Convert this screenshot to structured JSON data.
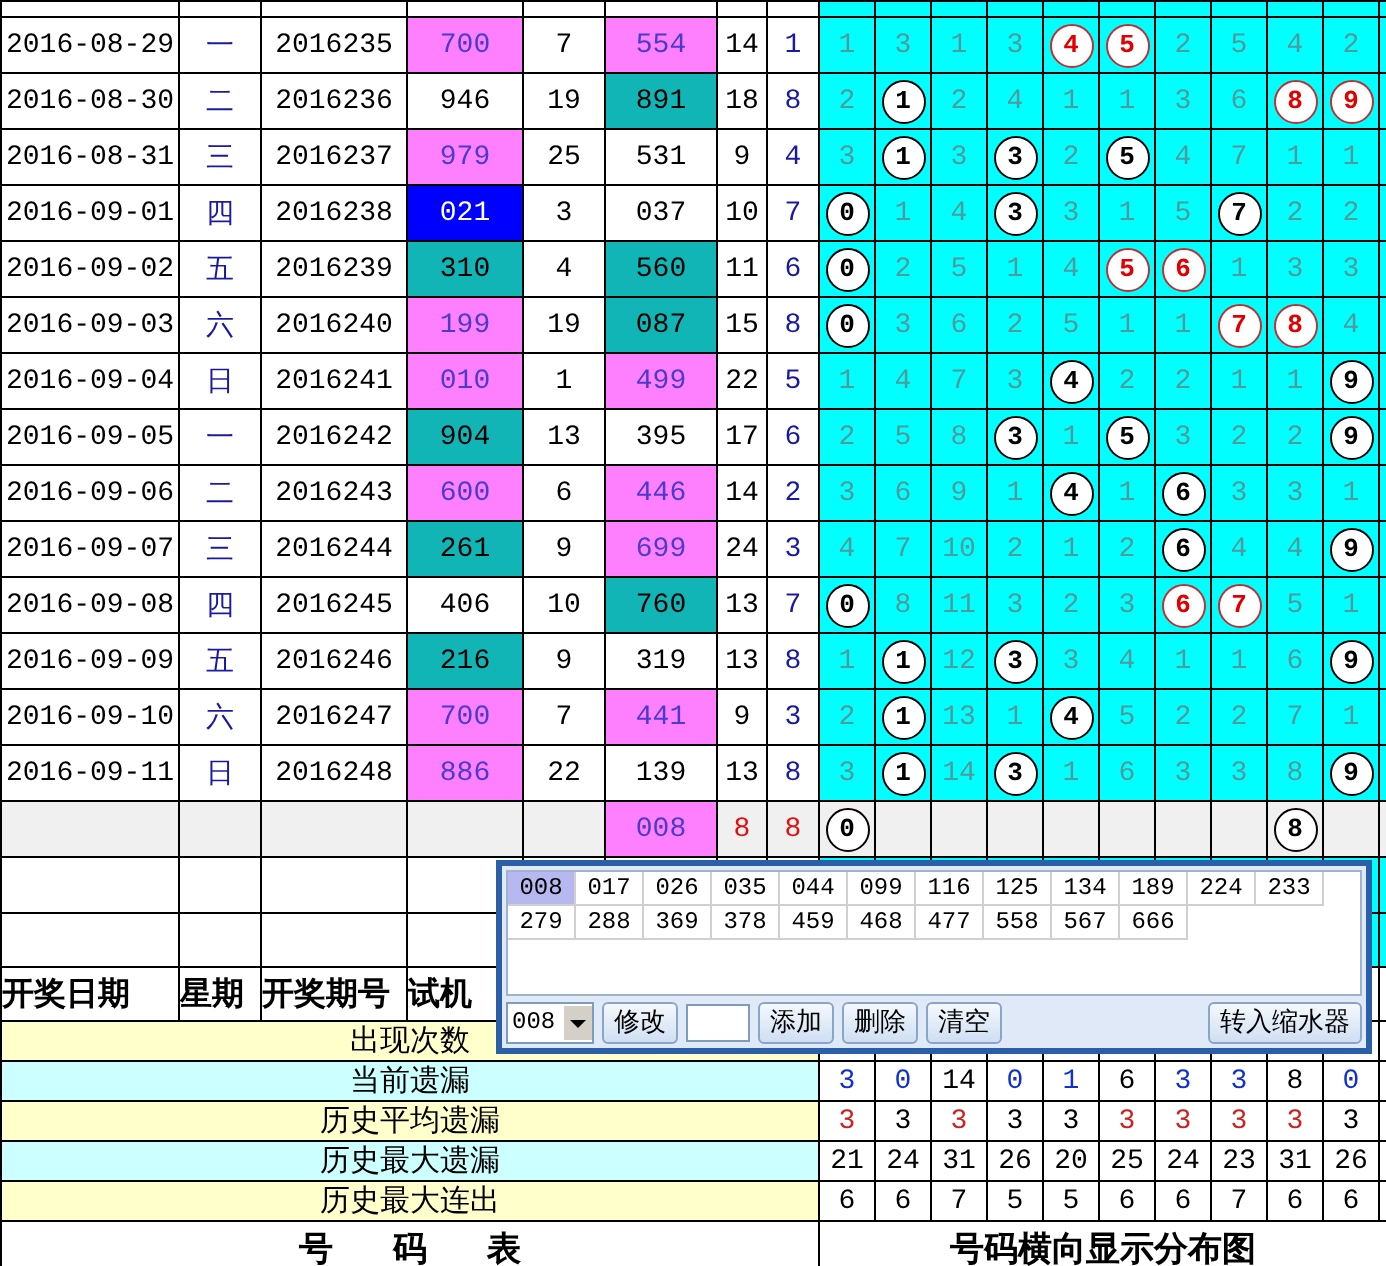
{
  "draws": [
    {
      "date": "2016-08-29",
      "weekday": "一",
      "issue": "2016235",
      "test": {
        "text": "700",
        "kind": "pink"
      },
      "c5": "7",
      "c6": {
        "text": "554",
        "kind": "pink"
      },
      "c7": "14",
      "c8": "1",
      "grid": [
        {
          "text": "1",
          "kind": "miss"
        },
        {
          "text": "3",
          "kind": "miss"
        },
        {
          "text": "1",
          "kind": "miss"
        },
        {
          "text": "3",
          "kind": "miss"
        },
        {
          "text": "4",
          "kind": "hit_red"
        },
        {
          "text": "5",
          "kind": "hit_red"
        },
        {
          "text": "2",
          "kind": "miss"
        },
        {
          "text": "5",
          "kind": "miss"
        },
        {
          "text": "4",
          "kind": "miss"
        },
        {
          "text": "2",
          "kind": "miss"
        }
      ]
    },
    {
      "date": "2016-08-30",
      "weekday": "二",
      "issue": "2016236",
      "test": {
        "text": "946",
        "kind": "white"
      },
      "c5": "19",
      "c6": {
        "text": "891",
        "kind": "teal"
      },
      "c7": "18",
      "c8": "8",
      "grid": [
        {
          "text": "2",
          "kind": "miss"
        },
        {
          "text": "1",
          "kind": "hit"
        },
        {
          "text": "2",
          "kind": "miss"
        },
        {
          "text": "4",
          "kind": "miss"
        },
        {
          "text": "1",
          "kind": "miss"
        },
        {
          "text": "1",
          "kind": "miss"
        },
        {
          "text": "3",
          "kind": "miss"
        },
        {
          "text": "6",
          "kind": "miss"
        },
        {
          "text": "8",
          "kind": "hit_red"
        },
        {
          "text": "9",
          "kind": "hit_red"
        }
      ]
    },
    {
      "date": "2016-08-31",
      "weekday": "三",
      "issue": "2016237",
      "test": {
        "text": "979",
        "kind": "pink"
      },
      "c5": "25",
      "c6": {
        "text": "531",
        "kind": "white"
      },
      "c7": "9",
      "c8": "4",
      "grid": [
        {
          "text": "3",
          "kind": "miss"
        },
        {
          "text": "1",
          "kind": "hit"
        },
        {
          "text": "3",
          "kind": "miss"
        },
        {
          "text": "3",
          "kind": "hit"
        },
        {
          "text": "2",
          "kind": "miss"
        },
        {
          "text": "5",
          "kind": "hit"
        },
        {
          "text": "4",
          "kind": "miss"
        },
        {
          "text": "7",
          "kind": "miss"
        },
        {
          "text": "1",
          "kind": "miss"
        },
        {
          "text": "1",
          "kind": "miss"
        }
      ]
    },
    {
      "date": "2016-09-01",
      "weekday": "四",
      "issue": "2016238",
      "test": {
        "text": "021",
        "kind": "blue"
      },
      "c5": "3",
      "c6": {
        "text": "037",
        "kind": "white"
      },
      "c7": "10",
      "c8": "7",
      "grid": [
        {
          "text": "0",
          "kind": "hit"
        },
        {
          "text": "1",
          "kind": "miss"
        },
        {
          "text": "4",
          "kind": "miss"
        },
        {
          "text": "3",
          "kind": "hit"
        },
        {
          "text": "3",
          "kind": "miss"
        },
        {
          "text": "1",
          "kind": "miss"
        },
        {
          "text": "5",
          "kind": "miss"
        },
        {
          "text": "7",
          "kind": "hit"
        },
        {
          "text": "2",
          "kind": "miss"
        },
        {
          "text": "2",
          "kind": "miss"
        }
      ]
    },
    {
      "date": "2016-09-02",
      "weekday": "五",
      "issue": "2016239",
      "test": {
        "text": "310",
        "kind": "teal"
      },
      "c5": "4",
      "c6": {
        "text": "560",
        "kind": "teal"
      },
      "c7": "11",
      "c8": "6",
      "grid": [
        {
          "text": "0",
          "kind": "hit"
        },
        {
          "text": "2",
          "kind": "miss"
        },
        {
          "text": "5",
          "kind": "miss"
        },
        {
          "text": "1",
          "kind": "miss"
        },
        {
          "text": "4",
          "kind": "miss"
        },
        {
          "text": "5",
          "kind": "hit_red"
        },
        {
          "text": "6",
          "kind": "hit_red"
        },
        {
          "text": "1",
          "kind": "miss"
        },
        {
          "text": "3",
          "kind": "miss"
        },
        {
          "text": "3",
          "kind": "miss"
        }
      ]
    },
    {
      "date": "2016-09-03",
      "weekday": "六",
      "issue": "2016240",
      "test": {
        "text": "199",
        "kind": "pink"
      },
      "c5": "19",
      "c6": {
        "text": "087",
        "kind": "teal"
      },
      "c7": "15",
      "c8": "8",
      "grid": [
        {
          "text": "0",
          "kind": "hit"
        },
        {
          "text": "3",
          "kind": "miss"
        },
        {
          "text": "6",
          "kind": "miss"
        },
        {
          "text": "2",
          "kind": "miss"
        },
        {
          "text": "5",
          "kind": "miss"
        },
        {
          "text": "1",
          "kind": "miss"
        },
        {
          "text": "1",
          "kind": "miss"
        },
        {
          "text": "7",
          "kind": "hit_red"
        },
        {
          "text": "8",
          "kind": "hit_red"
        },
        {
          "text": "4",
          "kind": "miss"
        }
      ]
    },
    {
      "date": "2016-09-04",
      "weekday": "日",
      "issue": "2016241",
      "test": {
        "text": "010",
        "kind": "pink"
      },
      "c5": "1",
      "c6": {
        "text": "499",
        "kind": "pink"
      },
      "c7": "22",
      "c8": "5",
      "grid": [
        {
          "text": "1",
          "kind": "miss"
        },
        {
          "text": "4",
          "kind": "miss"
        },
        {
          "text": "7",
          "kind": "miss"
        },
        {
          "text": "3",
          "kind": "miss"
        },
        {
          "text": "4",
          "kind": "hit"
        },
        {
          "text": "2",
          "kind": "miss"
        },
        {
          "text": "2",
          "kind": "miss"
        },
        {
          "text": "1",
          "kind": "miss"
        },
        {
          "text": "1",
          "kind": "miss"
        },
        {
          "text": "9",
          "kind": "hit"
        }
      ]
    },
    {
      "date": "2016-09-05",
      "weekday": "一",
      "issue": "2016242",
      "test": {
        "text": "904",
        "kind": "teal"
      },
      "c5": "13",
      "c6": {
        "text": "395",
        "kind": "white"
      },
      "c7": "17",
      "c8": "6",
      "grid": [
        {
          "text": "2",
          "kind": "miss"
        },
        {
          "text": "5",
          "kind": "miss"
        },
        {
          "text": "8",
          "kind": "miss"
        },
        {
          "text": "3",
          "kind": "hit"
        },
        {
          "text": "1",
          "kind": "miss"
        },
        {
          "text": "5",
          "kind": "hit"
        },
        {
          "text": "3",
          "kind": "miss"
        },
        {
          "text": "2",
          "kind": "miss"
        },
        {
          "text": "2",
          "kind": "miss"
        },
        {
          "text": "9",
          "kind": "hit"
        }
      ]
    },
    {
      "date": "2016-09-06",
      "weekday": "二",
      "issue": "2016243",
      "test": {
        "text": "600",
        "kind": "pink"
      },
      "c5": "6",
      "c6": {
        "text": "446",
        "kind": "pink"
      },
      "c7": "14",
      "c8": "2",
      "grid": [
        {
          "text": "3",
          "kind": "miss"
        },
        {
          "text": "6",
          "kind": "miss"
        },
        {
          "text": "9",
          "kind": "miss"
        },
        {
          "text": "1",
          "kind": "miss"
        },
        {
          "text": "4",
          "kind": "hit"
        },
        {
          "text": "1",
          "kind": "miss"
        },
        {
          "text": "6",
          "kind": "hit"
        },
        {
          "text": "3",
          "kind": "miss"
        },
        {
          "text": "3",
          "kind": "miss"
        },
        {
          "text": "1",
          "kind": "miss"
        }
      ]
    },
    {
      "date": "2016-09-07",
      "weekday": "三",
      "issue": "2016244",
      "test": {
        "text": "261",
        "kind": "teal"
      },
      "c5": "9",
      "c6": {
        "text": "699",
        "kind": "pink"
      },
      "c7": "24",
      "c8": "3",
      "grid": [
        {
          "text": "4",
          "kind": "miss"
        },
        {
          "text": "7",
          "kind": "miss"
        },
        {
          "text": "10",
          "kind": "miss"
        },
        {
          "text": "2",
          "kind": "miss"
        },
        {
          "text": "1",
          "kind": "miss"
        },
        {
          "text": "2",
          "kind": "miss"
        },
        {
          "text": "6",
          "kind": "hit"
        },
        {
          "text": "4",
          "kind": "miss"
        },
        {
          "text": "4",
          "kind": "miss"
        },
        {
          "text": "9",
          "kind": "hit"
        }
      ]
    },
    {
      "date": "2016-09-08",
      "weekday": "四",
      "issue": "2016245",
      "test": {
        "text": "406",
        "kind": "white"
      },
      "c5": "10",
      "c6": {
        "text": "760",
        "kind": "teal"
      },
      "c7": "13",
      "c8": "7",
      "grid": [
        {
          "text": "0",
          "kind": "hit"
        },
        {
          "text": "8",
          "kind": "miss"
        },
        {
          "text": "11",
          "kind": "miss"
        },
        {
          "text": "3",
          "kind": "miss"
        },
        {
          "text": "2",
          "kind": "miss"
        },
        {
          "text": "3",
          "kind": "miss"
        },
        {
          "text": "6",
          "kind": "hit_red"
        },
        {
          "text": "7",
          "kind": "hit_red"
        },
        {
          "text": "5",
          "kind": "miss"
        },
        {
          "text": "1",
          "kind": "miss"
        }
      ]
    },
    {
      "date": "2016-09-09",
      "weekday": "五",
      "issue": "2016246",
      "test": {
        "text": "216",
        "kind": "teal"
      },
      "c5": "9",
      "c6": {
        "text": "319",
        "kind": "white"
      },
      "c7": "13",
      "c8": "8",
      "grid": [
        {
          "text": "1",
          "kind": "miss"
        },
        {
          "text": "1",
          "kind": "hit"
        },
        {
          "text": "12",
          "kind": "miss"
        },
        {
          "text": "3",
          "kind": "hit"
        },
        {
          "text": "3",
          "kind": "miss"
        },
        {
          "text": "4",
          "kind": "miss"
        },
        {
          "text": "1",
          "kind": "miss"
        },
        {
          "text": "1",
          "kind": "miss"
        },
        {
          "text": "6",
          "kind": "miss"
        },
        {
          "text": "9",
          "kind": "hit"
        }
      ]
    },
    {
      "date": "2016-09-10",
      "weekday": "六",
      "issue": "2016247",
      "test": {
        "text": "700",
        "kind": "pink"
      },
      "c5": "7",
      "c6": {
        "text": "441",
        "kind": "pink"
      },
      "c7": "9",
      "c8": "3",
      "grid": [
        {
          "text": "2",
          "kind": "miss"
        },
        {
          "text": "1",
          "kind": "hit"
        },
        {
          "text": "13",
          "kind": "miss"
        },
        {
          "text": "1",
          "kind": "miss"
        },
        {
          "text": "4",
          "kind": "hit"
        },
        {
          "text": "5",
          "kind": "miss"
        },
        {
          "text": "2",
          "kind": "miss"
        },
        {
          "text": "2",
          "kind": "miss"
        },
        {
          "text": "7",
          "kind": "miss"
        },
        {
          "text": "1",
          "kind": "miss"
        }
      ]
    },
    {
      "date": "2016-09-11",
      "weekday": "日",
      "issue": "2016248",
      "test": {
        "text": "886",
        "kind": "pink"
      },
      "c5": "22",
      "c6": {
        "text": "139",
        "kind": "white"
      },
      "c7": "13",
      "c8": "8",
      "grid": [
        {
          "text": "3",
          "kind": "miss"
        },
        {
          "text": "1",
          "kind": "hit"
        },
        {
          "text": "14",
          "kind": "miss"
        },
        {
          "text": "3",
          "kind": "hit"
        },
        {
          "text": "1",
          "kind": "miss"
        },
        {
          "text": "6",
          "kind": "miss"
        },
        {
          "text": "3",
          "kind": "miss"
        },
        {
          "text": "3",
          "kind": "miss"
        },
        {
          "text": "8",
          "kind": "miss"
        },
        {
          "text": "9",
          "kind": "hit"
        }
      ]
    }
  ],
  "forecast": {
    "c6": {
      "text": "008",
      "kind": "pink"
    },
    "c7": "8",
    "c8": "8",
    "grid": [
      {
        "text": "0",
        "kind": "hit"
      },
      {
        "kind": "blank"
      },
      {
        "kind": "blank"
      },
      {
        "kind": "blank"
      },
      {
        "kind": "blank"
      },
      {
        "kind": "blank"
      },
      {
        "kind": "blank"
      },
      {
        "kind": "blank"
      },
      {
        "text": "8",
        "kind": "hit"
      },
      {
        "kind": "blank"
      }
    ]
  },
  "columns": [
    "开奖日期",
    "星期",
    "开奖期号",
    "试机"
  ],
  "stats": [
    {
      "label": "出现次数"
    },
    {
      "label": "当前遗漏",
      "values": [
        {
          "text": "3",
          "kind": "blue"
        },
        {
          "text": "0",
          "kind": "blue"
        },
        {
          "text": "14",
          "kind": "plain"
        },
        {
          "text": "0",
          "kind": "blue"
        },
        {
          "text": "1",
          "kind": "blue"
        },
        {
          "text": "6",
          "kind": "plain"
        },
        {
          "text": "3",
          "kind": "blue"
        },
        {
          "text": "3",
          "kind": "blue"
        },
        {
          "text": "8",
          "kind": "plain"
        },
        {
          "text": "0",
          "kind": "blue"
        }
      ]
    },
    {
      "label": "历史平均遗漏",
      "values": [
        {
          "text": "3",
          "kind": "red"
        },
        {
          "text": "3",
          "kind": "plain"
        },
        {
          "text": "3",
          "kind": "red"
        },
        {
          "text": "3",
          "kind": "plain"
        },
        {
          "text": "3",
          "kind": "plain"
        },
        {
          "text": "3",
          "kind": "red"
        },
        {
          "text": "3",
          "kind": "red"
        },
        {
          "text": "3",
          "kind": "red"
        },
        {
          "text": "3",
          "kind": "red"
        },
        {
          "text": "3",
          "kind": "plain"
        }
      ]
    },
    {
      "label": "历史最大遗漏",
      "values": [
        {
          "text": "21",
          "kind": "plain"
        },
        {
          "text": "24",
          "kind": "plain"
        },
        {
          "text": "31",
          "kind": "plain"
        },
        {
          "text": "26",
          "kind": "plain"
        },
        {
          "text": "20",
          "kind": "plain"
        },
        {
          "text": "25",
          "kind": "plain"
        },
        {
          "text": "24",
          "kind": "plain"
        },
        {
          "text": "23",
          "kind": "plain"
        },
        {
          "text": "31",
          "kind": "plain"
        },
        {
          "text": "26",
          "kind": "plain"
        }
      ]
    },
    {
      "label": "历史最大连出",
      "values": [
        {
          "text": "6",
          "kind": "plain"
        },
        {
          "text": "6",
          "kind": "plain"
        },
        {
          "text": "7",
          "kind": "plain"
        },
        {
          "text": "5",
          "kind": "plain"
        },
        {
          "text": "5",
          "kind": "plain"
        },
        {
          "text": "6",
          "kind": "plain"
        },
        {
          "text": "6",
          "kind": "plain"
        },
        {
          "text": "7",
          "kind": "plain"
        },
        {
          "text": "6",
          "kind": "plain"
        },
        {
          "text": "6",
          "kind": "plain"
        }
      ]
    }
  ],
  "footer": [
    "号 码 表",
    "号码横向显示分布图"
  ],
  "popup": {
    "items": [
      {
        "text": "008",
        "selected": true
      },
      {
        "text": "017",
        "selected": false
      },
      {
        "text": "026",
        "selected": false
      },
      {
        "text": "035",
        "selected": false
      },
      {
        "text": "044",
        "selected": false
      },
      {
        "text": "099",
        "selected": false
      },
      {
        "text": "116",
        "selected": false
      },
      {
        "text": "125",
        "selected": false
      },
      {
        "text": "134",
        "selected": false
      },
      {
        "text": "189",
        "selected": false
      },
      {
        "text": "224",
        "selected": false
      },
      {
        "text": "233",
        "selected": false
      },
      {
        "text": "279",
        "selected": false
      },
      {
        "text": "288",
        "selected": false
      },
      {
        "text": "369",
        "selected": false
      },
      {
        "text": "378",
        "selected": false
      },
      {
        "text": "459",
        "selected": false
      },
      {
        "text": "468",
        "selected": false
      },
      {
        "text": "477",
        "selected": false
      },
      {
        "text": "558",
        "selected": false
      },
      {
        "text": "567",
        "selected": false
      },
      {
        "text": "666",
        "selected": false
      }
    ],
    "toolbar": [
      {
        "kind": "combo",
        "value": "008"
      },
      {
        "kind": "button",
        "label": "修改"
      },
      {
        "kind": "input"
      },
      {
        "kind": "button",
        "label": "添加"
      },
      {
        "kind": "button",
        "label": "删除"
      },
      {
        "kind": "button",
        "label": "清空"
      },
      {
        "kind": "far_button",
        "label": "转入缩水器"
      }
    ]
  }
}
